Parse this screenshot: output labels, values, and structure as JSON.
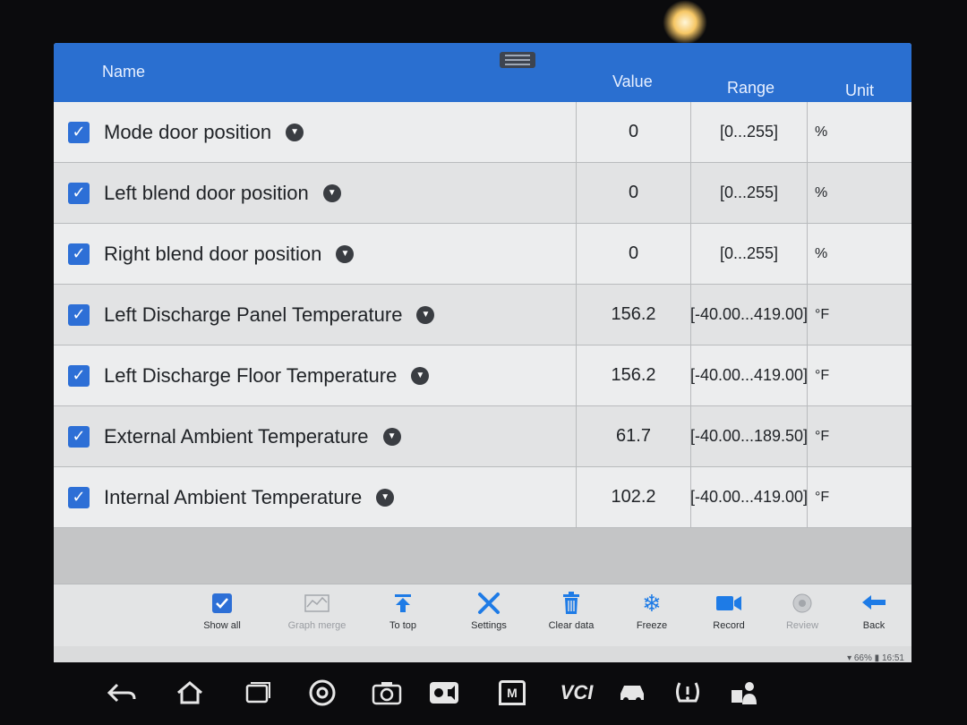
{
  "header": {
    "name": "Name",
    "value": "Value",
    "range": "Range",
    "unit": "Unit"
  },
  "rows": [
    {
      "name": "Mode door position",
      "value": "0",
      "range": "[0...255]",
      "unit": "%",
      "checked": true
    },
    {
      "name": "Left blend door position",
      "value": "0",
      "range": "[0...255]",
      "unit": "%",
      "checked": true
    },
    {
      "name": "Right blend door position",
      "value": "0",
      "range": "[0...255]",
      "unit": "%",
      "checked": true
    },
    {
      "name": "Left Discharge Panel Temperature",
      "value": "156.2",
      "range": "[-40.00...419.00]",
      "unit": "°F",
      "checked": true
    },
    {
      "name": "Left Discharge Floor Temperature",
      "value": "156.2",
      "range": "[-40.00...419.00]",
      "unit": "°F",
      "checked": true
    },
    {
      "name": "External Ambient Temperature",
      "value": "61.7",
      "range": "[-40.00...189.50]",
      "unit": "°F",
      "checked": true
    },
    {
      "name": "Internal Ambient Temperature",
      "value": "102.2",
      "range": "[-40.00...419.00]",
      "unit": "°F",
      "checked": true
    }
  ],
  "toolbar": {
    "show_all": "Show all",
    "graph_merge": "Graph merge",
    "to_top": "To top",
    "settings": "Settings",
    "clear_data": "Clear data",
    "freeze": "Freeze",
    "record": "Record",
    "review": "Review",
    "back": "Back"
  },
  "status": {
    "battery": "66%",
    "time": "16:51"
  },
  "nav": {
    "vci_label": "VCI",
    "home_label": "M"
  },
  "colors": {
    "header_blue": "#2a6fd0",
    "checkbox_blue": "#2d6fd6",
    "icon_blue": "#1e7be6"
  }
}
